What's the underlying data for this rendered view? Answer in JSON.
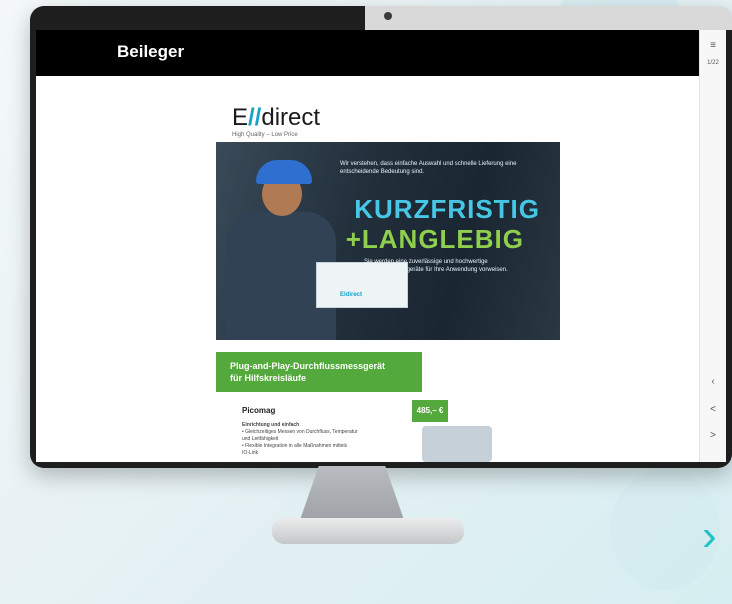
{
  "app": {
    "title": "Beileger"
  },
  "rail": {
    "menu_icon": "≡",
    "page_label": "1/22",
    "prev_icon": "‹",
    "back_icon": "<",
    "forward_icon": ">"
  },
  "brand": {
    "logo_prefix": "E",
    "logo_accent": "//",
    "logo_suffix": "direct",
    "slogan": "High Quality – Low Price"
  },
  "hero": {
    "intro": "Wir verstehen, dass einfache Auswahl und schnelle Lieferung eine entscheidende Bedeutung sind.",
    "headline_1": "KURZFRISTIG",
    "headline_2": "+LANGLEBIG",
    "note": "Sie werden eine zuverlässige und hochwertige Durchflussmessgeräte für Ihre Anwendung vorweisen.",
    "box_label": "Eldirect"
  },
  "banner": {
    "line_1": "Plug-and-Play-Durchflussmessgerät",
    "line_2": "für Hilfskreisläufe"
  },
  "product": {
    "title": "Picomag",
    "lines": [
      "Einrichtung und einfach",
      "• Gleichzeitiges Messen von Durchfluss, Temperatur",
      "  und Leitfähigkeit",
      "• Flexible Integration in alle Maßnahmen mittels",
      "  IO-Link"
    ],
    "price": "485,– €"
  },
  "accent_colors": {
    "green": "#53a93b",
    "cyan": "#46c7e6",
    "brand": "#16a3c7"
  }
}
